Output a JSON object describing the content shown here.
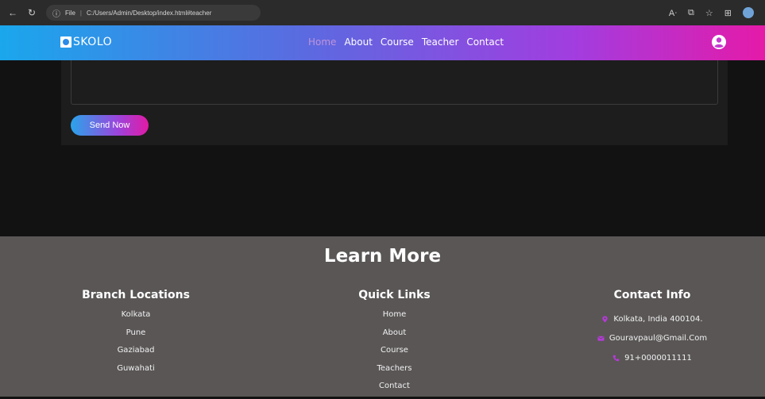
{
  "browser": {
    "file_label": "File",
    "url": "C:/Users/Admin/Desktop/index.html#teacher",
    "icons": [
      "back-icon",
      "refresh-icon",
      "info-icon",
      "read-aloud-icon",
      "tab-icon",
      "favorites-icon",
      "collections-icon",
      "profile-icon"
    ]
  },
  "navbar": {
    "logo": "SKOLO",
    "menu": [
      "Home",
      "About",
      "Course",
      "Teacher",
      "Contact"
    ],
    "active": "Home",
    "colors": {
      "gradient_start": "#1aa7ec",
      "gradient_end": "#e51aa8"
    }
  },
  "form": {
    "send_button": "Send Now"
  },
  "footer": {
    "title": "Learn More",
    "branch": {
      "heading": "Branch Locations",
      "items": [
        "Kolkata",
        "Pune",
        "Gaziabad",
        "Guwahati"
      ]
    },
    "quick_links": {
      "heading": "Quick Links",
      "items": [
        "Home",
        "About",
        "Course",
        "Teachers",
        "Contact"
      ]
    },
    "contact": {
      "heading": "Contact Info",
      "address": "Kolkata, India 400104.",
      "email": "Gouravpaul@Gmail.Com",
      "phone": "91+0000011111",
      "icon_color": "#b63ad9"
    }
  }
}
